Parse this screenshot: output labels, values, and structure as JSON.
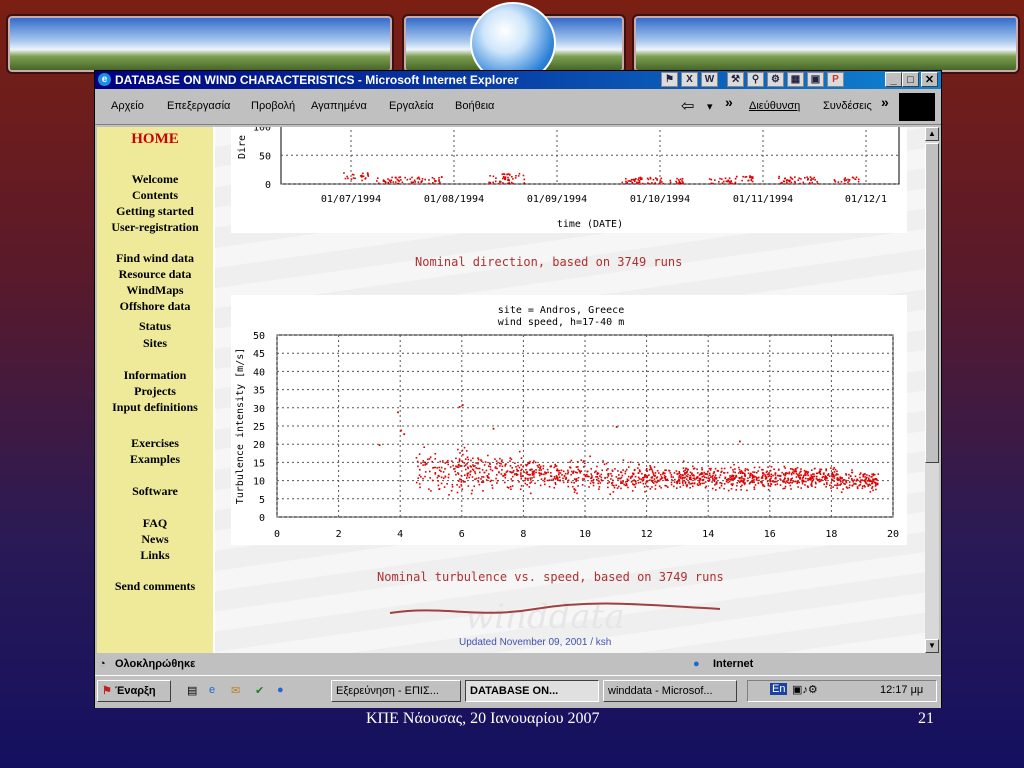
{
  "window": {
    "title": "DATABASE ON WIND CHARACTERISTICS - Microsoft Internet Explorer",
    "controls": {
      "minimize": "_",
      "maximize": "□",
      "close": "✕"
    }
  },
  "menubar": {
    "items": [
      "Αρχείο",
      "Επεξεργασία",
      "Προβολή",
      "Αγαπημένα",
      "Εργαλεία",
      "Βοήθεια"
    ],
    "back_arrow": "⇦",
    "dropdown": "▾",
    "chevron": "»",
    "address_label": "Διεύθυνση",
    "links_label": "Συνδέσεις"
  },
  "nav": {
    "home": "HOME",
    "group1": [
      "Welcome",
      "Contents",
      "Getting started",
      "User-registration"
    ],
    "group2": [
      "Find wind data",
      "Resource data",
      "WindMaps",
      "Offshore data"
    ],
    "group3": [
      "Status",
      "Sites"
    ],
    "group4": [
      "Information",
      "Projects",
      "Input definitions"
    ],
    "group5": [
      "Exercises",
      "Examples"
    ],
    "group6": [
      "Software"
    ],
    "group7": [
      "FAQ",
      "News",
      "Links"
    ],
    "group8": [
      "Send comments"
    ]
  },
  "captions": {
    "direction": "Nominal direction, based on 3749 runs",
    "turbulence": "Nominal turbulence vs. speed, based on 3749 runs",
    "updated": "Updated November 09, 2001 / ksh",
    "watermark": "winddata"
  },
  "chart_data": [
    {
      "type": "scatter",
      "title": "",
      "ylabel": "Dire",
      "xlabel": "time (DATE)",
      "y_ticks": [
        "0",
        "50",
        "100"
      ],
      "x_ticks": [
        "01/07/1994",
        "01/08/1994",
        "01/09/1994",
        "01/10/1994",
        "01/11/1994",
        "01/12/1"
      ],
      "ylim": [
        0,
        120
      ],
      "grid": true,
      "color": "#dd0000",
      "clusters": [
        {
          "x": 1.05,
          "y": [
            5,
            20
          ]
        },
        {
          "x": 1.35,
          "y": [
            0,
            12
          ]
        },
        {
          "x": 1.55,
          "y": [
            0,
            12
          ]
        },
        {
          "x": 1.75,
          "y": [
            0,
            12
          ]
        },
        {
          "x": 2.45,
          "y": [
            0,
            18
          ]
        },
        {
          "x": 2.55,
          "y": [
            0,
            18
          ]
        },
        {
          "x": 3.7,
          "y": [
            0,
            10
          ]
        },
        {
          "x": 3.85,
          "y": [
            0,
            12
          ]
        },
        {
          "x": 4.1,
          "y": [
            0,
            10
          ]
        },
        {
          "x": 4.6,
          "y": [
            0,
            10
          ]
        },
        {
          "x": 4.8,
          "y": [
            2,
            14
          ]
        },
        {
          "x": 5.25,
          "y": [
            0,
            15
          ]
        },
        {
          "x": 5.4,
          "y": [
            0,
            12
          ]
        },
        {
          "x": 5.8,
          "y": [
            0,
            12
          ]
        }
      ]
    },
    {
      "type": "scatter",
      "title": "site = Andros, Greece",
      "subtitle": "wind speed, h=17-40 m",
      "ylabel": "Turbulence intensity [m/s]",
      "xlabel": "",
      "x_ticks": [
        "0",
        "2",
        "4",
        "6",
        "8",
        "10",
        "12",
        "14",
        "16",
        "18",
        "20"
      ],
      "y_ticks": [
        "0",
        "5",
        "10",
        "15",
        "20",
        "25",
        "30",
        "35",
        "40",
        "45",
        "50"
      ],
      "xlim": [
        0,
        20
      ],
      "ylim": [
        0,
        50
      ],
      "grid": true,
      "color": "#dd0000",
      "n_points": 3749,
      "band": {
        "x_range": [
          4.5,
          19.5
        ],
        "center": [
          [
            4.5,
            13
          ],
          [
            6,
            13
          ],
          [
            8,
            12
          ],
          [
            10,
            11.5
          ],
          [
            12,
            11
          ],
          [
            14,
            11
          ],
          [
            16,
            11
          ],
          [
            18,
            11
          ],
          [
            19.5,
            10
          ]
        ],
        "spread": [
          [
            4.5,
            4
          ],
          [
            6,
            4
          ],
          [
            8,
            3
          ],
          [
            10,
            2.5
          ],
          [
            12,
            2.5
          ],
          [
            14,
            2
          ],
          [
            16,
            2
          ],
          [
            18,
            2
          ],
          [
            19.5,
            1.5
          ]
        ]
      },
      "outliers": [
        [
          3.9,
          29
        ],
        [
          4.0,
          24
        ],
        [
          4.1,
          23
        ],
        [
          3.3,
          20
        ],
        [
          5.9,
          30.5
        ],
        [
          6.0,
          31
        ],
        [
          11.0,
          25
        ],
        [
          15.0,
          21
        ],
        [
          7.0,
          24.5
        ]
      ]
    }
  ],
  "status": {
    "text": "Ολοκληρώθηκε",
    "zone": "Internet"
  },
  "taskbar": {
    "start": "Έναρξη",
    "tasks": [
      "Εξερεύνηση - ΕΠΙΣ...",
      "DATABASE ON...",
      "winddata - Microsof..."
    ],
    "lang": "En",
    "clock": "12:17 μμ"
  },
  "footer": {
    "left": "ΚΠΕ Νάουσας, 20 Ιανουαρίου 2007",
    "page": "21"
  }
}
